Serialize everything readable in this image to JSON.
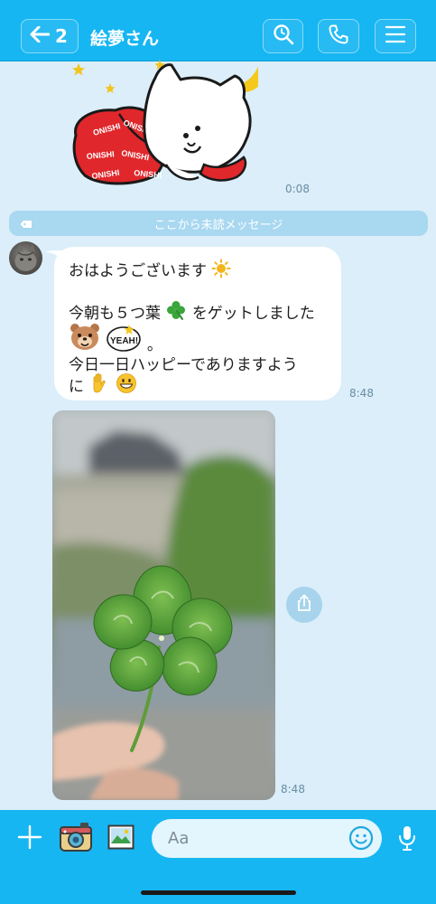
{
  "header": {
    "back_count": "2",
    "title": "絵夢さん",
    "bg_color": "#16b6f2"
  },
  "sticker": {
    "label_text": "ONISHI",
    "time": "0:08"
  },
  "unread_divider": {
    "label": "ここから未読メッセージ"
  },
  "message": {
    "lines": [
      "おはようございます",
      "今朝も５つ葉",
      "をゲットしました",
      "。",
      "今日一日ハッピーでありますよう",
      "に"
    ],
    "sticker_text": "YEAH!",
    "time": "8:48"
  },
  "photo": {
    "time": "8:48"
  },
  "footer": {
    "input_placeholder": "Aa"
  },
  "icons": [
    "back-arrow-icon",
    "search-icon",
    "phone-icon",
    "menu-icon",
    "share-icon",
    "plus-icon",
    "camera-icon",
    "image-icon",
    "smiley-icon",
    "mic-icon"
  ]
}
